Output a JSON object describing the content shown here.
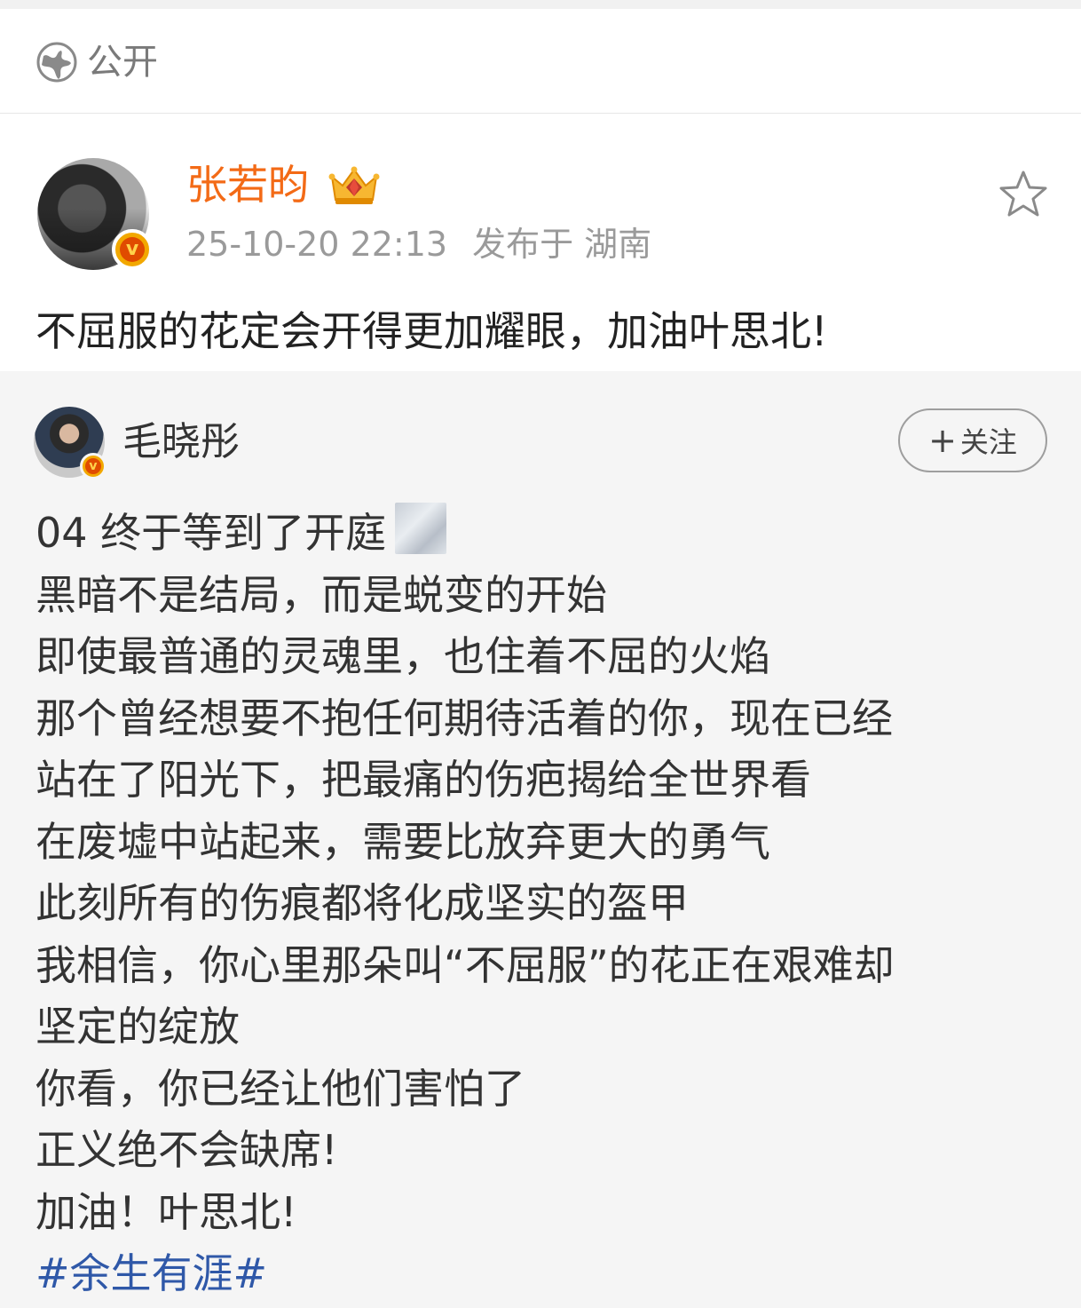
{
  "visibility": {
    "label": "公开",
    "icon": "globe-icon"
  },
  "post": {
    "author": "张若昀",
    "timestamp": "25-10-20 22:13",
    "location": "发布于 湖南",
    "text": "不屈服的花定会开得更加耀眼，加油叶思北!",
    "verified_badge": "v",
    "icons": [
      "crown-icon",
      "star-icon"
    ]
  },
  "repost": {
    "author": "毛晓彤",
    "verified_badge": "v",
    "follow_label": "关注",
    "follow_plus": "+",
    "lines": [
      "04 终于等到了开庭",
      "黑暗不是结局，而是蜕变的开始",
      "即使最普通的灵魂里，也住着不屈的火焰",
      "那个曾经想要不抱任何期待活着的你，现在已经",
      "站在了阳光下，把最痛的伤疤揭给全世界看",
      "在废墟中站起来，需要比放弃更大的勇气",
      "此刻所有的伤痕都将化成坚实的盔甲",
      "我相信，你心里那朵叫“不屈服”的花正在艰难却",
      "坚定的绽放",
      "你看，你已经让他们害怕了",
      "正义绝不会缺席!",
      "加油！叶思北!"
    ],
    "hashtag": "#余生有涯#"
  },
  "colors": {
    "author_name": "#f36a16",
    "meta": "#9a9a9a",
    "hashtag": "#2f58a8",
    "repost_bg": "#f5f5f5"
  }
}
